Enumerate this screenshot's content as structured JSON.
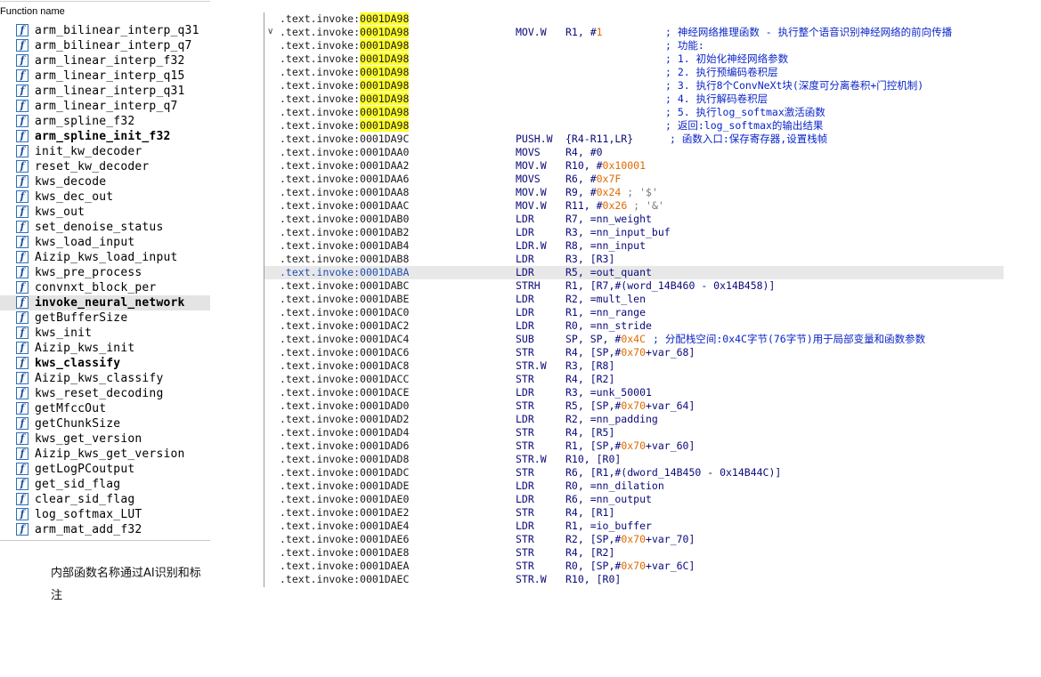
{
  "function_panel": {
    "header": "Function name",
    "icon_glyph": "f",
    "items": [
      {
        "label": "arm_bilinear_interp_q31",
        "bold": false,
        "selected": false
      },
      {
        "label": "arm_bilinear_interp_q7",
        "bold": false,
        "selected": false
      },
      {
        "label": "arm_linear_interp_f32",
        "bold": false,
        "selected": false
      },
      {
        "label": "arm_linear_interp_q15",
        "bold": false,
        "selected": false
      },
      {
        "label": "arm_linear_interp_q31",
        "bold": false,
        "selected": false
      },
      {
        "label": "arm_linear_interp_q7",
        "bold": false,
        "selected": false
      },
      {
        "label": "arm_spline_f32",
        "bold": false,
        "selected": false
      },
      {
        "label": "arm_spline_init_f32",
        "bold": true,
        "selected": false
      },
      {
        "label": "init_kw_decoder",
        "bold": false,
        "selected": false
      },
      {
        "label": "reset_kw_decoder",
        "bold": false,
        "selected": false
      },
      {
        "label": "kws_decode",
        "bold": false,
        "selected": false
      },
      {
        "label": "kws_dec_out",
        "bold": false,
        "selected": false
      },
      {
        "label": "kws_out",
        "bold": false,
        "selected": false
      },
      {
        "label": "set_denoise_status",
        "bold": false,
        "selected": false
      },
      {
        "label": "kws_load_input",
        "bold": false,
        "selected": false
      },
      {
        "label": "Aizip_kws_load_input",
        "bold": false,
        "selected": false
      },
      {
        "label": "kws_pre_process",
        "bold": false,
        "selected": false
      },
      {
        "label": "convnxt_block_per",
        "bold": false,
        "selected": false
      },
      {
        "label": "invoke_neural_network",
        "bold": true,
        "selected": true
      },
      {
        "label": "getBufferSize",
        "bold": false,
        "selected": false
      },
      {
        "label": "kws_init",
        "bold": false,
        "selected": false
      },
      {
        "label": "Aizip_kws_init",
        "bold": false,
        "selected": false
      },
      {
        "label": "kws_classify",
        "bold": true,
        "selected": false
      },
      {
        "label": "Aizip_kws_classify",
        "bold": false,
        "selected": false
      },
      {
        "label": "kws_reset_decoding",
        "bold": false,
        "selected": false
      },
      {
        "label": "getMfccOut",
        "bold": false,
        "selected": false
      },
      {
        "label": "getChunkSize",
        "bold": false,
        "selected": false
      },
      {
        "label": "kws_get_version",
        "bold": false,
        "selected": false
      },
      {
        "label": "Aizip_kws_get_version",
        "bold": false,
        "selected": false
      },
      {
        "label": "getLogPCoutput",
        "bold": false,
        "selected": false
      },
      {
        "label": "get_sid_flag",
        "bold": false,
        "selected": false
      },
      {
        "label": "clear_sid_flag",
        "bold": false,
        "selected": false
      },
      {
        "label": "log_softmax_LUT",
        "bold": false,
        "selected": false
      },
      {
        "label": "arm_mat_add_f32",
        "bold": false,
        "selected": false
      }
    ]
  },
  "note": "内部函数名称通过AI识别和标注",
  "disassembly": {
    "fold_glyph": "∨",
    "lines": [
      {
        "seg": ".text.invoke:",
        "addr": "0001DA98",
        "hl": true,
        "mnem": "",
        "ops": [],
        "comment": ""
      },
      {
        "seg": ".text.invoke:",
        "addr": "0001DA98",
        "hl": true,
        "fold": true,
        "mnem": "MOV.W",
        "ops": [
          {
            "t": "R1, #"
          },
          {
            "t": "1",
            "n": true
          }
        ],
        "comment": "; 神经网络推理函数 - 执行整个语音识别神经网络的前向传播"
      },
      {
        "seg": ".text.invoke:",
        "addr": "0001DA98",
        "hl": true,
        "mnem": "",
        "ops": [],
        "comment": "; 功能:"
      },
      {
        "seg": ".text.invoke:",
        "addr": "0001DA98",
        "hl": true,
        "mnem": "",
        "ops": [],
        "comment": "; 1. 初始化神经网络参数"
      },
      {
        "seg": ".text.invoke:",
        "addr": "0001DA98",
        "hl": true,
        "mnem": "",
        "ops": [],
        "comment": "; 2. 执行预编码卷积层"
      },
      {
        "seg": ".text.invoke:",
        "addr": "0001DA98",
        "hl": true,
        "mnem": "",
        "ops": [],
        "comment": "; 3. 执行8个ConvNeXt块(深度可分离卷积+门控机制)"
      },
      {
        "seg": ".text.invoke:",
        "addr": "0001DA98",
        "hl": true,
        "mnem": "",
        "ops": [],
        "comment": "; 4. 执行解码卷积层"
      },
      {
        "seg": ".text.invoke:",
        "addr": "0001DA98",
        "hl": true,
        "mnem": "",
        "ops": [],
        "comment": "; 5. 执行log_softmax激活函数"
      },
      {
        "seg": ".text.invoke:",
        "addr": "0001DA98",
        "hl": true,
        "mnem": "",
        "ops": [],
        "comment": "; 返回:log_softmax的输出结果"
      },
      {
        "seg": ".text.invoke:",
        "addr": "0001DA9C",
        "hl": false,
        "mnem": "PUSH.W",
        "ops": [
          {
            "t": "{R4-R11,LR}"
          }
        ],
        "comment": "; 函数入口:保存寄存器,设置栈帧",
        "cmt_class": "mid"
      },
      {
        "seg": ".text.invoke:",
        "addr": "0001DAA0",
        "hl": false,
        "mnem": "MOVS",
        "ops": [
          {
            "t": "R4, #0"
          }
        ],
        "comment": ""
      },
      {
        "seg": ".text.invoke:",
        "addr": "0001DAA2",
        "hl": false,
        "mnem": "MOV.W",
        "ops": [
          {
            "t": "R10, #"
          },
          {
            "t": "0x10001",
            "n": true
          }
        ],
        "comment": ""
      },
      {
        "seg": ".text.invoke:",
        "addr": "0001DAA6",
        "hl": false,
        "mnem": "MOVS",
        "ops": [
          {
            "t": "R6, #"
          },
          {
            "t": "0x7F",
            "n": true
          }
        ],
        "comment": ""
      },
      {
        "seg": ".text.invoke:",
        "addr": "0001DAA8",
        "hl": false,
        "mnem": "MOV.W",
        "ops": [
          {
            "t": "R9, #"
          },
          {
            "t": "0x24",
            "n": true
          },
          {
            "t": " ; '$'",
            "c": true
          }
        ],
        "comment": ""
      },
      {
        "seg": ".text.invoke:",
        "addr": "0001DAAC",
        "hl": false,
        "mnem": "MOV.W",
        "ops": [
          {
            "t": "R11, #"
          },
          {
            "t": "0x26",
            "n": true
          },
          {
            "t": " ; '&'",
            "c": true
          }
        ],
        "comment": ""
      },
      {
        "seg": ".text.invoke:",
        "addr": "0001DAB0",
        "hl": false,
        "mnem": "LDR",
        "ops": [
          {
            "t": "R7, =nn_weight"
          }
        ],
        "comment": ""
      },
      {
        "seg": ".text.invoke:",
        "addr": "0001DAB2",
        "hl": false,
        "mnem": "LDR",
        "ops": [
          {
            "t": "R3, =nn_input_buf"
          }
        ],
        "comment": ""
      },
      {
        "seg": ".text.invoke:",
        "addr": "0001DAB4",
        "hl": false,
        "mnem": "LDR.W",
        "ops": [
          {
            "t": "R8, =nn_input"
          }
        ],
        "comment": ""
      },
      {
        "seg": ".text.invoke:",
        "addr": "0001DAB8",
        "hl": false,
        "mnem": "LDR",
        "ops": [
          {
            "t": "R3, [R3]"
          }
        ],
        "comment": ""
      },
      {
        "seg": ".text.invoke:",
        "addr": "0001DABA",
        "hl": false,
        "current": true,
        "mnem": "LDR",
        "ops": [
          {
            "t": "R5, =out_quant"
          }
        ],
        "comment": ""
      },
      {
        "seg": ".text.invoke:",
        "addr": "0001DABC",
        "hl": false,
        "mnem": "STRH",
        "ops": [
          {
            "t": "R1, [R7,#(word_14B460 - 0x14B458)]"
          }
        ],
        "comment": ""
      },
      {
        "seg": ".text.invoke:",
        "addr": "0001DABE",
        "hl": false,
        "mnem": "LDR",
        "ops": [
          {
            "t": "R2, =mult_len"
          }
        ],
        "comment": ""
      },
      {
        "seg": ".text.invoke:",
        "addr": "0001DAC0",
        "hl": false,
        "mnem": "LDR",
        "ops": [
          {
            "t": "R1, =nn_range"
          }
        ],
        "comment": ""
      },
      {
        "seg": ".text.invoke:",
        "addr": "0001DAC2",
        "hl": false,
        "mnem": "LDR",
        "ops": [
          {
            "t": "R0, =nn_stride"
          }
        ],
        "comment": ""
      },
      {
        "seg": ".text.invoke:",
        "addr": "0001DAC4",
        "hl": false,
        "mnem": "SUB",
        "ops": [
          {
            "t": "SP, SP, #"
          },
          {
            "t": "0x4C",
            "n": true
          }
        ],
        "comment": "; 分配栈空间:0x4C字节(76字节)用于局部变量和函数参数",
        "cmt_class": "late"
      },
      {
        "seg": ".text.invoke:",
        "addr": "0001DAC6",
        "hl": false,
        "mnem": "STR",
        "ops": [
          {
            "t": "R4, [SP,#"
          },
          {
            "t": "0x70",
            "n": true
          },
          {
            "t": "+var_68]"
          }
        ],
        "comment": ""
      },
      {
        "seg": ".text.invoke:",
        "addr": "0001DAC8",
        "hl": false,
        "mnem": "STR.W",
        "ops": [
          {
            "t": "R3, [R8]"
          }
        ],
        "comment": ""
      },
      {
        "seg": ".text.invoke:",
        "addr": "0001DACC",
        "hl": false,
        "mnem": "STR",
        "ops": [
          {
            "t": "R4, [R2]"
          }
        ],
        "comment": ""
      },
      {
        "seg": ".text.invoke:",
        "addr": "0001DACE",
        "hl": false,
        "mnem": "LDR",
        "ops": [
          {
            "t": "R3, =unk_50001"
          }
        ],
        "comment": ""
      },
      {
        "seg": ".text.invoke:",
        "addr": "0001DAD0",
        "hl": false,
        "mnem": "STR",
        "ops": [
          {
            "t": "R5, [SP,#"
          },
          {
            "t": "0x70",
            "n": true
          },
          {
            "t": "+var_64]"
          }
        ],
        "comment": ""
      },
      {
        "seg": ".text.invoke:",
        "addr": "0001DAD2",
        "hl": false,
        "mnem": "LDR",
        "ops": [
          {
            "t": "R2, =nn_padding"
          }
        ],
        "comment": ""
      },
      {
        "seg": ".text.invoke:",
        "addr": "0001DAD4",
        "hl": false,
        "mnem": "STR",
        "ops": [
          {
            "t": "R4, [R5]"
          }
        ],
        "comment": ""
      },
      {
        "seg": ".text.invoke:",
        "addr": "0001DAD6",
        "hl": false,
        "mnem": "STR",
        "ops": [
          {
            "t": "R1, [SP,#"
          },
          {
            "t": "0x70",
            "n": true
          },
          {
            "t": "+var_60]"
          }
        ],
        "comment": ""
      },
      {
        "seg": ".text.invoke:",
        "addr": "0001DAD8",
        "hl": false,
        "mnem": "STR.W",
        "ops": [
          {
            "t": "R10, [R0]"
          }
        ],
        "comment": ""
      },
      {
        "seg": ".text.invoke:",
        "addr": "0001DADC",
        "hl": false,
        "mnem": "STR",
        "ops": [
          {
            "t": "R6, [R1,#(dword_14B450 - 0x14B44C)]"
          }
        ],
        "comment": ""
      },
      {
        "seg": ".text.invoke:",
        "addr": "0001DADE",
        "hl": false,
        "mnem": "LDR",
        "ops": [
          {
            "t": "R0, =nn_dilation"
          }
        ],
        "comment": ""
      },
      {
        "seg": ".text.invoke:",
        "addr": "0001DAE0",
        "hl": false,
        "mnem": "LDR",
        "ops": [
          {
            "t": "R6, =nn_output"
          }
        ],
        "comment": ""
      },
      {
        "seg": ".text.invoke:",
        "addr": "0001DAE2",
        "hl": false,
        "mnem": "STR",
        "ops": [
          {
            "t": "R4, [R1]"
          }
        ],
        "comment": ""
      },
      {
        "seg": ".text.invoke:",
        "addr": "0001DAE4",
        "hl": false,
        "mnem": "LDR",
        "ops": [
          {
            "t": "R1, =io_buffer"
          }
        ],
        "comment": ""
      },
      {
        "seg": ".text.invoke:",
        "addr": "0001DAE6",
        "hl": false,
        "mnem": "STR",
        "ops": [
          {
            "t": "R2, [SP,#"
          },
          {
            "t": "0x70",
            "n": true
          },
          {
            "t": "+var_70]"
          }
        ],
        "comment": ""
      },
      {
        "seg": ".text.invoke:",
        "addr": "0001DAE8",
        "hl": false,
        "mnem": "STR",
        "ops": [
          {
            "t": "R4, [R2]"
          }
        ],
        "comment": ""
      },
      {
        "seg": ".text.invoke:",
        "addr": "0001DAEA",
        "hl": false,
        "mnem": "STR",
        "ops": [
          {
            "t": "R0, [SP,#"
          },
          {
            "t": "0x70",
            "n": true
          },
          {
            "t": "+var_6C]"
          }
        ],
        "comment": ""
      },
      {
        "seg": ".text.invoke:",
        "addr": "0001DAEC",
        "hl": false,
        "mnem": "STR.W",
        "ops": [
          {
            "t": "R10, [R0]"
          }
        ],
        "comment": ""
      }
    ]
  }
}
